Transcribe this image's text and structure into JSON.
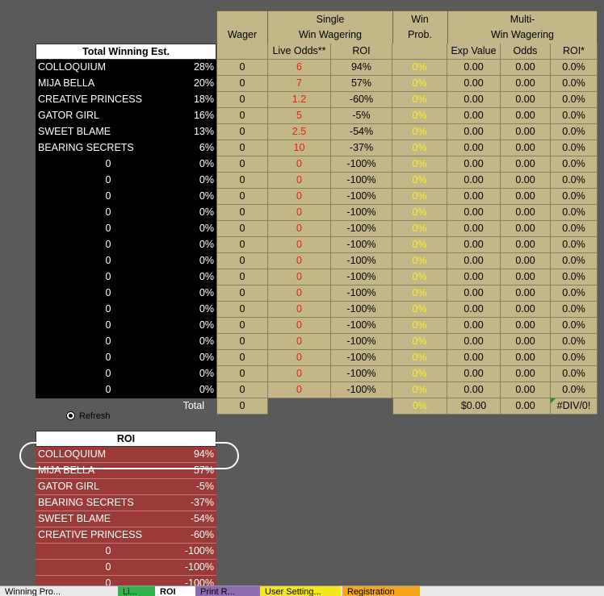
{
  "headers": {
    "wager": "Wager",
    "single_top": "Single",
    "single_bottom": "Win Wagering",
    "winprob_top": "Win",
    "winprob_bottom": "Prob.",
    "multi_top": "Multi-",
    "multi_bottom": "Win Wagering",
    "total_winning": "Total Winning Est.",
    "live_odds": "Live Odds**",
    "roi": "ROI",
    "exp_value": "Exp Value",
    "odds": "Odds",
    "roi_multi": "ROI*"
  },
  "rows": [
    {
      "name": "COLLOQUIUM",
      "pct": "28%",
      "wager": "0",
      "live_odds": "6",
      "roi": "94%",
      "win_prob": "0%",
      "exp": "0.00",
      "odds": "0.00",
      "roi_multi": "0.0%"
    },
    {
      "name": "MIJA BELLA",
      "pct": "20%",
      "wager": "0",
      "live_odds": "7",
      "roi": "57%",
      "win_prob": "0%",
      "exp": "0.00",
      "odds": "0.00",
      "roi_multi": "0.0%"
    },
    {
      "name": "CREATIVE PRINCESS",
      "pct": "18%",
      "wager": "0",
      "live_odds": "1.2",
      "roi": "-60%",
      "win_prob": "0%",
      "exp": "0.00",
      "odds": "0.00",
      "roi_multi": "0.0%"
    },
    {
      "name": "GATOR GIRL",
      "pct": "16%",
      "wager": "0",
      "live_odds": "5",
      "roi": "-5%",
      "win_prob": "0%",
      "exp": "0.00",
      "odds": "0.00",
      "roi_multi": "0.0%"
    },
    {
      "name": "SWEET BLAME",
      "pct": "13%",
      "wager": "0",
      "live_odds": "2.5",
      "roi": "-54%",
      "win_prob": "0%",
      "exp": "0.00",
      "odds": "0.00",
      "roi_multi": "0.0%"
    },
    {
      "name": "BEARING SECRETS",
      "pct": "6%",
      "wager": "0",
      "live_odds": "10",
      "roi": "-37%",
      "win_prob": "0%",
      "exp": "0.00",
      "odds": "0.00",
      "roi_multi": "0.0%"
    },
    {
      "name": "0",
      "pct": "0%",
      "wager": "0",
      "live_odds": "0",
      "roi": "-100%",
      "win_prob": "0%",
      "exp": "0.00",
      "odds": "0.00",
      "roi_multi": "0.0%"
    },
    {
      "name": "0",
      "pct": "0%",
      "wager": "0",
      "live_odds": "0",
      "roi": "-100%",
      "win_prob": "0%",
      "exp": "0.00",
      "odds": "0.00",
      "roi_multi": "0.0%"
    },
    {
      "name": "0",
      "pct": "0%",
      "wager": "0",
      "live_odds": "0",
      "roi": "-100%",
      "win_prob": "0%",
      "exp": "0.00",
      "odds": "0.00",
      "roi_multi": "0.0%"
    },
    {
      "name": "0",
      "pct": "0%",
      "wager": "0",
      "live_odds": "0",
      "roi": "-100%",
      "win_prob": "0%",
      "exp": "0.00",
      "odds": "0.00",
      "roi_multi": "0.0%"
    },
    {
      "name": "0",
      "pct": "0%",
      "wager": "0",
      "live_odds": "0",
      "roi": "-100%",
      "win_prob": "0%",
      "exp": "0.00",
      "odds": "0.00",
      "roi_multi": "0.0%"
    },
    {
      "name": "0",
      "pct": "0%",
      "wager": "0",
      "live_odds": "0",
      "roi": "-100%",
      "win_prob": "0%",
      "exp": "0.00",
      "odds": "0.00",
      "roi_multi": "0.0%"
    },
    {
      "name": "0",
      "pct": "0%",
      "wager": "0",
      "live_odds": "0",
      "roi": "-100%",
      "win_prob": "0%",
      "exp": "0.00",
      "odds": "0.00",
      "roi_multi": "0.0%"
    },
    {
      "name": "0",
      "pct": "0%",
      "wager": "0",
      "live_odds": "0",
      "roi": "-100%",
      "win_prob": "0%",
      "exp": "0.00",
      "odds": "0.00",
      "roi_multi": "0.0%"
    },
    {
      "name": "0",
      "pct": "0%",
      "wager": "0",
      "live_odds": "0",
      "roi": "-100%",
      "win_prob": "0%",
      "exp": "0.00",
      "odds": "0.00",
      "roi_multi": "0.0%"
    },
    {
      "name": "0",
      "pct": "0%",
      "wager": "0",
      "live_odds": "0",
      "roi": "-100%",
      "win_prob": "0%",
      "exp": "0.00",
      "odds": "0.00",
      "roi_multi": "0.0%"
    },
    {
      "name": "0",
      "pct": "0%",
      "wager": "0",
      "live_odds": "0",
      "roi": "-100%",
      "win_prob": "0%",
      "exp": "0.00",
      "odds": "0.00",
      "roi_multi": "0.0%"
    },
    {
      "name": "0",
      "pct": "0%",
      "wager": "0",
      "live_odds": "0",
      "roi": "-100%",
      "win_prob": "0%",
      "exp": "0.00",
      "odds": "0.00",
      "roi_multi": "0.0%"
    },
    {
      "name": "0",
      "pct": "0%",
      "wager": "0",
      "live_odds": "0",
      "roi": "-100%",
      "win_prob": "0%",
      "exp": "0.00",
      "odds": "0.00",
      "roi_multi": "0.0%"
    },
    {
      "name": "0",
      "pct": "0%",
      "wager": "0",
      "live_odds": "0",
      "roi": "-100%",
      "win_prob": "0%",
      "exp": "0.00",
      "odds": "0.00",
      "roi_multi": "0.0%"
    },
    {
      "name": "0",
      "pct": "0%",
      "wager": "0",
      "live_odds": "0",
      "roi": "-100%",
      "win_prob": "0%",
      "exp": "0.00",
      "odds": "0.00",
      "roi_multi": "0.0%"
    }
  ],
  "totals": {
    "label": "Total",
    "wager": "0",
    "win_prob": "0%",
    "exp": "$0.00",
    "odds": "0.00",
    "roi_multi": "#DIV/0!"
  },
  "refresh_label": "Refresh",
  "roi_table": {
    "title": "ROI",
    "rows": [
      {
        "name": "COLLOQUIUM",
        "value": "94%"
      },
      {
        "name": "MIJA BELLA",
        "value": "57%"
      },
      {
        "name": "GATOR GIRL",
        "value": "-5%"
      },
      {
        "name": "BEARING SECRETS",
        "value": "-37%"
      },
      {
        "name": "SWEET BLAME",
        "value": "-54%"
      },
      {
        "name": "CREATIVE PRINCESS",
        "value": "-60%"
      },
      {
        "name": "0",
        "value": "-100%"
      },
      {
        "name": "0",
        "value": "-100%"
      },
      {
        "name": "0",
        "value": "-100%"
      }
    ]
  },
  "sheet_tabs": [
    {
      "label": "Winning Pro...",
      "color": "#e9e9e9"
    },
    {
      "label": "Li...",
      "color": "#2fb34a"
    },
    {
      "label": "ROI",
      "color": "#ffffff"
    },
    {
      "label": "Print R...",
      "color": "#8f6bb1"
    },
    {
      "label": "User Setting...",
      "color": "#f4e81a"
    },
    {
      "label": "Registration",
      "color": "#f7a51b"
    }
  ],
  "colors": {
    "background": "#5a5a5a",
    "tan": "#c3b688",
    "roi_red": "#9b3a38",
    "odds_red": "#e41f14",
    "prob_yellow": "#f5ec2a"
  }
}
